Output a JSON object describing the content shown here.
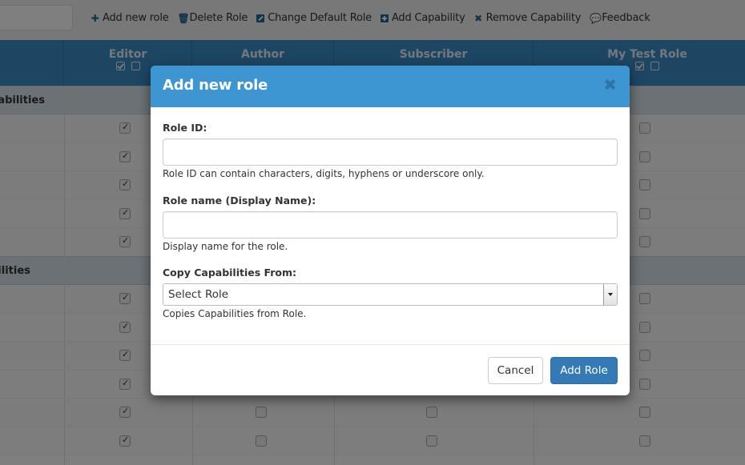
{
  "toolbar": {
    "search_placeholder": "",
    "actions": [
      {
        "label": "Add new role",
        "icon": "plus-icon"
      },
      {
        "label": "Delete Role",
        "icon": "trash-icon"
      },
      {
        "label": "Change Default Role",
        "icon": "edit-icon"
      },
      {
        "label": "Add Capability",
        "icon": "plus-square-icon"
      },
      {
        "label": "Remove Capability",
        "icon": "times-icon"
      },
      {
        "label": "Feedback",
        "icon": "comments-icon"
      }
    ]
  },
  "table": {
    "columns": [
      {
        "label": "Editor",
        "has_bulk_checks": true
      },
      {
        "label": "Author",
        "has_bulk_checks": false
      },
      {
        "label": "Subscriber",
        "has_bulk_checks": false
      },
      {
        "label": "My Test Role",
        "has_bulk_checks": true
      }
    ],
    "sections": [
      {
        "label": "pabilities",
        "rows": [
          {
            "editor": true,
            "my_test_role": false
          },
          {
            "editor": true,
            "my_test_role": false
          },
          {
            "editor": true,
            "my_test_role": false
          },
          {
            "editor": true,
            "my_test_role": false
          },
          {
            "editor": true,
            "my_test_role": false
          }
        ]
      },
      {
        "label": "bilities",
        "rows": [
          {
            "editor": true,
            "author": false,
            "subscriber": false,
            "my_test_role": false
          },
          {
            "editor": true,
            "author": false,
            "subscriber": false,
            "my_test_role": false
          },
          {
            "editor": true,
            "author": false,
            "subscriber": false,
            "my_test_role": false
          },
          {
            "editor": true,
            "author": false,
            "subscriber": false,
            "my_test_role": false
          },
          {
            "editor": true,
            "author": false,
            "subscriber": false,
            "my_test_role": false
          },
          {
            "editor": true,
            "author": false,
            "subscriber": false,
            "my_test_role": false
          }
        ]
      }
    ]
  },
  "modal": {
    "title": "Add new role",
    "close_icon": "times-icon",
    "fields": {
      "role_id": {
        "label": "Role ID:",
        "value": "",
        "placeholder": "",
        "help": "Role ID can contain characters, digits, hyphens or underscore only."
      },
      "role_name": {
        "label": "Role name (Display Name):",
        "value": "",
        "placeholder": "",
        "help": "Display name for the role."
      },
      "copy_from": {
        "label": "Copy Capabilities From:",
        "selected": "Select Role",
        "help": "Copies Capabilities from Role."
      }
    },
    "buttons": {
      "cancel": "Cancel",
      "submit": "Add Role"
    }
  },
  "colors": {
    "modal_header": "#3d95d2",
    "primary_button": "#337ab7",
    "table_header": "#3a8cc6",
    "toolbar_icon": "#1d6a93"
  }
}
